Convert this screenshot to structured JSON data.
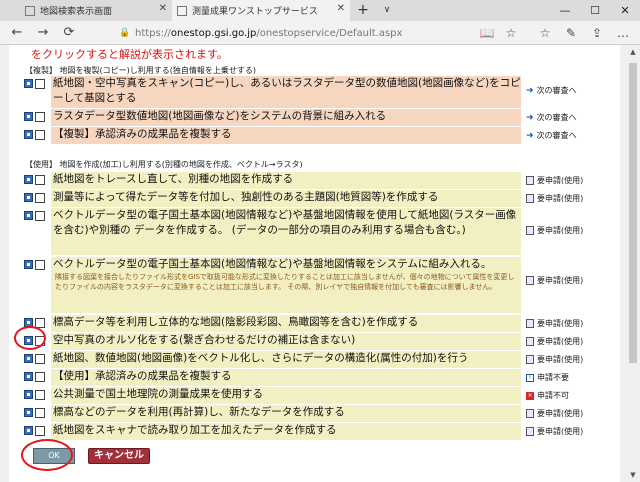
{
  "browser": {
    "tabs": [
      {
        "title": "地図検索表示画面",
        "active": false
      },
      {
        "title": "測量成果ワンストップサービス",
        "active": true
      }
    ],
    "new_tab_symbol": "+",
    "tab_menu_symbol": "∨",
    "window_buttons": {
      "minimize": "—",
      "maximize": "☐",
      "close": "✕"
    },
    "nav": {
      "back": "←",
      "forward": "→",
      "refresh": "⟳"
    },
    "url": {
      "lock": "🔒",
      "prefix": "https://",
      "host": "onestop.gsi.go.jp",
      "path": "/onestopservice/Default.aspx"
    },
    "tools": {
      "reading": "📖",
      "favorite": "☆",
      "favorites_bar": "☆",
      "pen": "✎",
      "share": "⇪",
      "more": "…"
    }
  },
  "page": {
    "notice": "をクリックすると解説が表示されます。",
    "copy_section": {
      "heading": "【複製】 地図を複製(コピー)し利用する(独自情報を上乗せする)",
      "rows": [
        {
          "text": "紙地図・空中写真をスキャン(コピー)し、あるいはラスタデータ型の数値地図(地図画像など)をコピーして基図とする",
          "link": "次の審査へ"
        },
        {
          "text": "ラスタデータ型数値地図(地図画像など)をシステムの背景に組み入れる",
          "link": "次の審査へ"
        },
        {
          "text": "【複製】承認済みの成果品を複製する",
          "link": "次の審査へ"
        }
      ]
    },
    "use_section": {
      "heading": "【使用】 地図を作成(加工)し利用する(別種の地図を作成、ベクトル→ラスタ)",
      "rows": [
        {
          "text": "紙地図をトレースし直して、別種の地図を作成する",
          "status": "要申請(使用)"
        },
        {
          "text": "測量等によって得たデータ等を付加し、独創性のある主題図(地質図等)を作成する",
          "status": "要申請(使用)"
        },
        {
          "text": "ベクトルデータ型の電子国土基本図(地図情報など)や基盤地図情報を使用して紙地図(ラスター画像を含む)や別種の データを作成する。 (データの一部分の項目のみ利用する場合も含む。)",
          "status": "要申請(使用)"
        },
        {
          "text": "ベクトルデータ型の電子国土基本図(地図情報など)や基盤地図情報をシステムに組み入れる。",
          "note": "隣接する図葉を接合したりファイル形式をGISで取扱可能な形式に変換したりすることは加工に該当しませんが、個々の地物について属性を変更したりファイルの内容をラスタデータに変換することは加工に該当します。 その際、別レイヤで独自情報を付加しても審査には影響しません。",
          "status": "要申請(使用)"
        },
        {
          "text": "標高データ等を利用し立体的な地図(陰影段彩図、鳥瞰図等を含む)を作成する",
          "status": "要申請(使用)"
        },
        {
          "text": "空中写真のオルソ化をする(繋ぎ合わせるだけの補正は含まない)",
          "status": "要申請(使用)"
        },
        {
          "text": "紙地図、数値地図(地図画像)をベクトル化し、さらにデータの構造化(属性の付加)を行う",
          "status": "要申請(使用)"
        },
        {
          "text": "【使用】承認済みの成果品を複製する",
          "status": "申請不要"
        },
        {
          "text": "公共測量で国土地理院の測量成果を使用する",
          "status": "申請不可"
        },
        {
          "text": "標高などのデータを利用(再計算)し、新たなデータを作成する",
          "status": "要申請(使用)"
        },
        {
          "text": "紙地図をスキャナで読み取り加工を加えたデータを作成する",
          "status": "要申請(使用)"
        }
      ]
    },
    "ok_label": "OK",
    "cancel_label": "キャンセル",
    "highlight_color": "#e8151b"
  }
}
